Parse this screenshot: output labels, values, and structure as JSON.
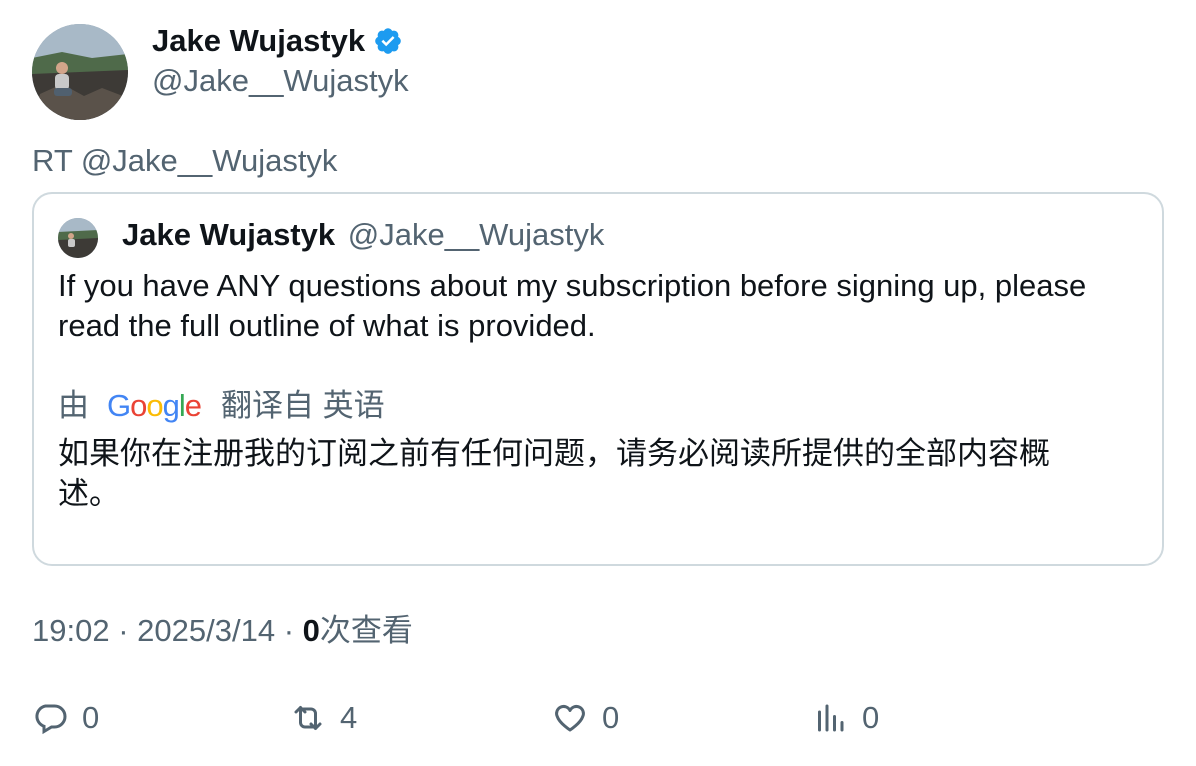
{
  "author": {
    "name": "Jake Wujastyk",
    "handle": "@Jake__Wujastyk",
    "verified": true
  },
  "retweet_line": "RT @Jake__Wujastyk",
  "quote": {
    "name": "Jake Wujastyk",
    "handle": "@Jake__Wujastyk",
    "text": "If you have ANY questions about my subscription before signing up, please read the full outline of what is provided.",
    "translate_prefix": "由",
    "translate_provider": "Google",
    "translate_suffix": "翻译自 英语",
    "translation": "如果你在注册我的订阅之前有任何问题，请务必阅读所提供的全部内容概述。"
  },
  "meta": {
    "time": "19:02",
    "separator": "·",
    "date": "2025/3/14",
    "views_count": "0",
    "views_label": "次查看"
  },
  "actions": {
    "replies": "0",
    "retweets": "4",
    "likes": "0",
    "views": "0"
  },
  "colors": {
    "text_primary": "#0f1419",
    "text_secondary": "#536471",
    "border": "#cfd9de",
    "verified": "#1d9bf0"
  },
  "icons": [
    "verified-badge-icon",
    "reply-icon",
    "retweet-icon",
    "like-icon",
    "views-icon"
  ]
}
